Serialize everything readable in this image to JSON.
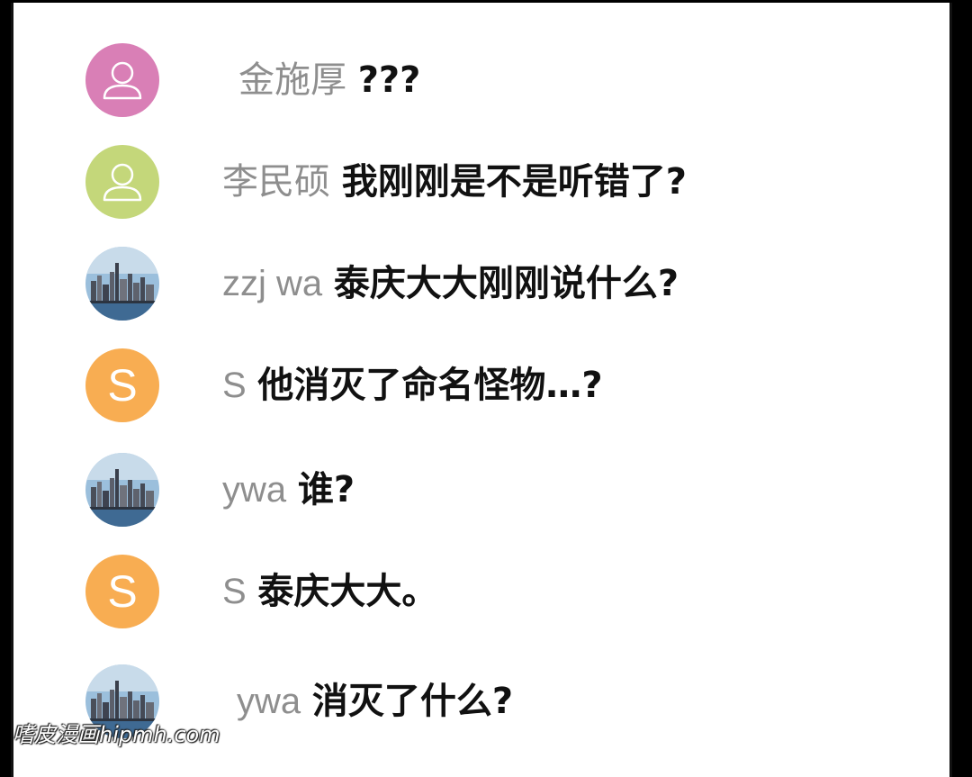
{
  "messages": [
    {
      "name": "金施厚",
      "text": "???",
      "avatar": {
        "type": "person-icon",
        "color": "#d97fb6"
      }
    },
    {
      "name": "李民硕",
      "text": "我刚刚是不是听错了?",
      "avatar": {
        "type": "person-icon",
        "color": "#c4d77a"
      }
    },
    {
      "name": "zzj wa",
      "text": "泰庆大大刚刚说什么?",
      "avatar": {
        "type": "city-skyline-photo"
      }
    },
    {
      "name": "S",
      "text": "他消灭了命名怪物…?",
      "avatar": {
        "type": "letter",
        "letter": "S",
        "color": "#f8ad52"
      }
    },
    {
      "name": "ywa",
      "text": "谁?",
      "avatar": {
        "type": "city-skyline-photo"
      }
    },
    {
      "name": "S",
      "text": "泰庆大大。",
      "avatar": {
        "type": "letter",
        "letter": "S",
        "color": "#f8ad52"
      }
    },
    {
      "name": "ywa",
      "text": "消灭了什么?",
      "avatar": {
        "type": "city-skyline-photo"
      }
    }
  ],
  "watermark": "嗜皮漫画hipmh.com"
}
